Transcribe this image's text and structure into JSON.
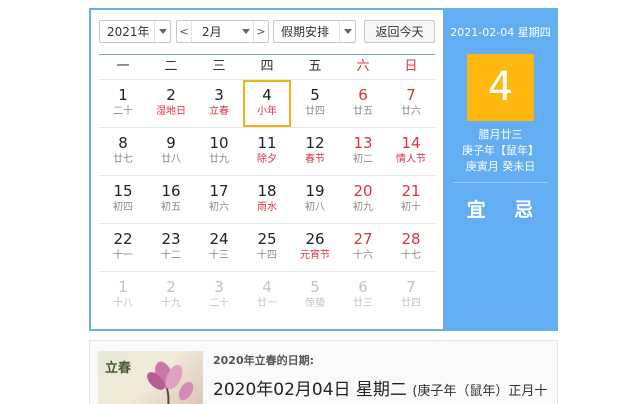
{
  "toolbar": {
    "year": "2021年",
    "month": "2月",
    "holiday": "假期安排",
    "today_label": "返回今天",
    "prev_glyph": "<",
    "next_glyph": ">"
  },
  "weekdays": [
    "一",
    "二",
    "三",
    "四",
    "五",
    "六",
    "日"
  ],
  "weeks": [
    [
      {
        "d": "1",
        "l": "二十"
      },
      {
        "d": "2",
        "l": "湿地日",
        "f": true
      },
      {
        "d": "3",
        "l": "立春",
        "f": true
      },
      {
        "d": "4",
        "l": "小年",
        "f": true,
        "sel": true
      },
      {
        "d": "5",
        "l": "廿四"
      },
      {
        "d": "6",
        "l": "廿五",
        "w": true
      },
      {
        "d": "7",
        "l": "廿六",
        "w": true
      }
    ],
    [
      {
        "d": "8",
        "l": "廿七"
      },
      {
        "d": "9",
        "l": "廿八"
      },
      {
        "d": "10",
        "l": "廿九"
      },
      {
        "d": "11",
        "l": "除夕",
        "f": true
      },
      {
        "d": "12",
        "l": "春节",
        "f": true
      },
      {
        "d": "13",
        "l": "初二",
        "w": true
      },
      {
        "d": "14",
        "l": "情人节",
        "w": true,
        "f": true
      }
    ],
    [
      {
        "d": "15",
        "l": "初四"
      },
      {
        "d": "16",
        "l": "初五"
      },
      {
        "d": "17",
        "l": "初六"
      },
      {
        "d": "18",
        "l": "雨水",
        "f": true
      },
      {
        "d": "19",
        "l": "初八"
      },
      {
        "d": "20",
        "l": "初九",
        "w": true
      },
      {
        "d": "21",
        "l": "初十",
        "w": true
      }
    ],
    [
      {
        "d": "22",
        "l": "十一"
      },
      {
        "d": "23",
        "l": "十二"
      },
      {
        "d": "24",
        "l": "十三"
      },
      {
        "d": "25",
        "l": "十四"
      },
      {
        "d": "26",
        "l": "元宵节",
        "f": true
      },
      {
        "d": "27",
        "l": "十六",
        "w": true
      },
      {
        "d": "28",
        "l": "十七",
        "w": true
      }
    ],
    [
      {
        "d": "1",
        "l": "十八",
        "o": true
      },
      {
        "d": "2",
        "l": "十九",
        "o": true
      },
      {
        "d": "3",
        "l": "二十",
        "o": true
      },
      {
        "d": "4",
        "l": "廿一",
        "o": true
      },
      {
        "d": "5",
        "l": "惊蛰",
        "o": true
      },
      {
        "d": "6",
        "l": "廿三",
        "o": true
      },
      {
        "d": "7",
        "l": "廿四",
        "o": true
      }
    ]
  ],
  "side": {
    "date": "2021-02-04 星期四",
    "day": "4",
    "lunar1": "腊月廿三",
    "lunar2": "庚子年【鼠年】",
    "lunar3": "庚寅月 癸未日",
    "yi": "宜",
    "ji": "忌"
  },
  "info": {
    "thumb_text": "立春",
    "title": "2020年立春的日期:",
    "main": "2020年02月04日 星期二",
    "tail": "(庚子年（鼠年）正月十"
  },
  "colors": {
    "accent": "#63adf3",
    "selected_border": "#f0b11a",
    "big_day_bg": "#ffb70f",
    "festival": "#d9333f"
  }
}
